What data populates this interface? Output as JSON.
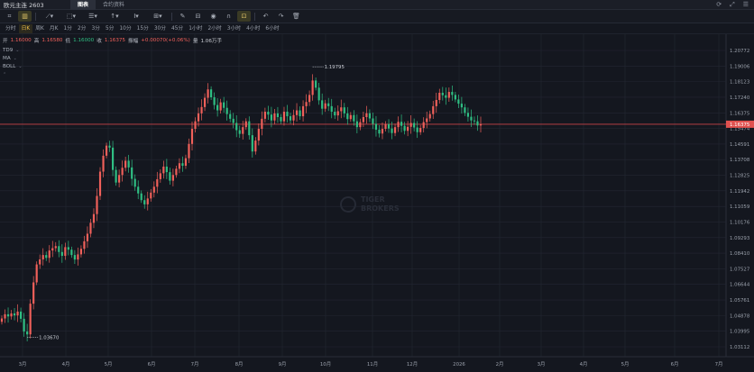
{
  "window": {
    "title": "欧元主连 2603",
    "tabs": [
      {
        "label": "图表",
        "active": true
      },
      {
        "label": "合约资料",
        "active": false
      }
    ],
    "right_icons": [
      "refresh-icon",
      "expand-icon",
      "close-icon"
    ]
  },
  "toolbar": {
    "tools": [
      "crosshair-icon",
      "chart-type-icon",
      "line-tool-icon",
      "rect-tool-icon",
      "layout-icon",
      "arrow-tool-icon",
      "text-tool-icon",
      "indicator-icon",
      "pen-icon",
      "ruler-icon",
      "eye-icon",
      "magnet-icon",
      "lock-icon",
      "undo-icon",
      "redo-icon",
      "delete-icon"
    ]
  },
  "periods": [
    "分时",
    "日K",
    "周K",
    "月K",
    "1分",
    "2分",
    "3分",
    "5分",
    "10分",
    "15分",
    "30分",
    "45分",
    "1小时",
    "2小时",
    "3小时",
    "4小时",
    "6小时"
  ],
  "active_period": "日K",
  "quote": {
    "open_label": "开",
    "open": "1.16000",
    "high_label": "高",
    "high": "1.16580",
    "low_label": "低",
    "low": "1.16000",
    "close_label": "收",
    "close": "1.16375",
    "change_label": "振幅",
    "change": "+0.00070(+0.06%)",
    "volume_label": "量",
    "volume": "1.06万手"
  },
  "indicators": [
    "TD9",
    "MA",
    "BOLL"
  ],
  "watermark": "TIGER BROKERS",
  "colors": {
    "up": "#f0605a",
    "down": "#2fbf83",
    "price_line": "#c9434a",
    "background": "#14171f",
    "grid": "#232733"
  },
  "chart_data": {
    "type": "candlestick",
    "y_ticks": [
      "1.20772",
      "1.19006",
      "1.18123",
      "1.17240",
      "1.16375",
      "1.15474",
      "1.14591",
      "1.13708",
      "1.12825",
      "1.11942",
      "1.11059",
      "1.10176",
      "1.09293",
      "1.08410",
      "1.07527",
      "1.06644",
      "1.05761",
      "1.04878",
      "1.03995",
      "1.03112"
    ],
    "ylim": [
      1.03112,
      1.20772
    ],
    "x_ticks": [
      "3月",
      "4月",
      "5月",
      "6月",
      "7月",
      "8月",
      "9月",
      "10月",
      "11月",
      "12月",
      "2026",
      "2月",
      "3月",
      "4月",
      "5月",
      "6月",
      "7月"
    ],
    "current_price": "1.16375",
    "annotations": [
      {
        "label": "1.19795",
        "value": 1.19795,
        "type": "high"
      },
      {
        "label": "1.03670",
        "value": 1.0367,
        "type": "low"
      }
    ],
    "closes": [
      1.048,
      1.0505,
      1.0492,
      1.051,
      1.0498,
      1.0521,
      1.0478,
      1.0402,
      1.0385,
      1.0568,
      1.0695,
      1.0802,
      1.0832,
      1.0858,
      1.0841,
      1.0885,
      1.0899,
      1.0911,
      1.0876,
      1.0853,
      1.0905,
      1.089,
      1.0858,
      1.0831,
      1.0862,
      1.0895,
      1.094,
      1.0985,
      1.105,
      1.1102,
      1.121,
      1.1355,
      1.145,
      1.151,
      1.1498,
      1.1365,
      1.129,
      1.1335,
      1.1378,
      1.142,
      1.138,
      1.1312,
      1.1265,
      1.1225,
      1.1185,
      1.116,
      1.1195,
      1.123,
      1.1265,
      1.131,
      1.1345,
      1.1385,
      1.1352,
      1.1301,
      1.1335,
      1.1372,
      1.1405,
      1.139,
      1.1435,
      1.152,
      1.161,
      1.1655,
      1.1702,
      1.174,
      1.1795,
      1.1845,
      1.1798,
      1.1752,
      1.172,
      1.1768,
      1.1735,
      1.1698,
      1.167,
      1.1645,
      1.1602,
      1.158,
      1.162,
      1.1655,
      1.1572,
      1.1475,
      1.154,
      1.161,
      1.167,
      1.1712,
      1.1695,
      1.166,
      1.1702,
      1.168,
      1.1655,
      1.1712,
      1.1685,
      1.166,
      1.1692,
      1.172,
      1.1685,
      1.1745,
      1.177,
      1.1812,
      1.1898,
      1.1855,
      1.178,
      1.173,
      1.1762,
      1.1745,
      1.1712,
      1.169,
      1.1715,
      1.1738,
      1.1702,
      1.1668,
      1.1692,
      1.1655,
      1.162,
      1.165,
      1.168,
      1.1703,
      1.1672,
      1.164,
      1.1605,
      1.1582,
      1.161,
      1.1638,
      1.1612,
      1.1585,
      1.162,
      1.1652,
      1.1628,
      1.1598,
      1.1622,
      1.1645,
      1.1618,
      1.159,
      1.1615,
      1.165,
      1.1672,
      1.1698,
      1.1745,
      1.1782,
      1.1825,
      1.181,
      1.1795,
      1.183,
      1.1812,
      1.1785,
      1.176,
      1.1738,
      1.1705,
      1.1682,
      1.166,
      1.1655,
      1.163,
      1.1637
    ]
  }
}
